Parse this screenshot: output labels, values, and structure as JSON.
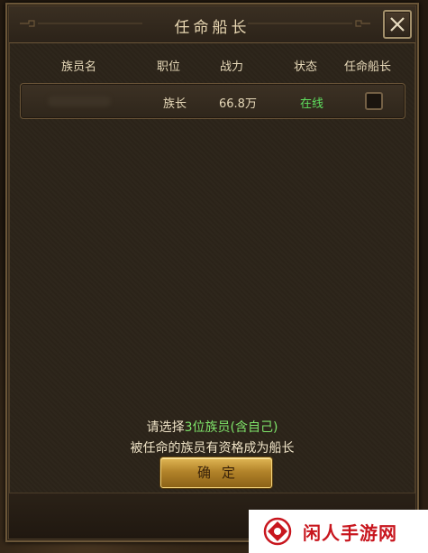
{
  "dialog": {
    "title": "任命船长",
    "columns": [
      "族员名",
      "职位",
      "战力",
      "状态",
      "任命船长"
    ],
    "members": [
      {
        "name": "",
        "rank": "族长",
        "power": "66.8万",
        "status": "在线",
        "selected": false
      }
    ],
    "hint": {
      "prefix": "请选择",
      "highlight": "3位族员(含自己)",
      "line2": "被任命的族员有资格成为船长"
    },
    "confirm_label": "确定"
  },
  "watermark": {
    "text": "闲人手游网"
  },
  "colors": {
    "accent_gold": "#d4a94a",
    "online_green": "#5fe05f",
    "frame": "#6b5638"
  }
}
